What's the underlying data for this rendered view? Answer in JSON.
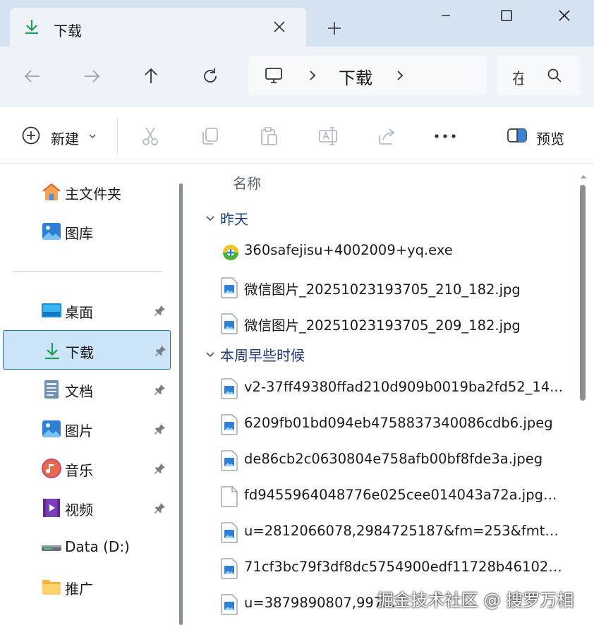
{
  "window": {
    "tab_title": "下载",
    "icons": {
      "tab": "download-icon",
      "close_tab": "close-icon",
      "new_tab": "plus-icon",
      "minimize": "minimize-icon",
      "maximize": "maximize-icon",
      "close": "close-icon"
    }
  },
  "nav": {
    "address": {
      "location": "下载",
      "root_icon": "this-pc-icon"
    },
    "search": {
      "placeholder_partial": "在"
    },
    "icons": {
      "back": "arrow-left-icon",
      "forward": "arrow-right-icon",
      "up": "arrow-up-icon",
      "refresh": "refresh-icon",
      "search": "search-icon"
    }
  },
  "toolbar": {
    "new_label": "新建",
    "preview_label": "预览",
    "icons": [
      "cut-icon",
      "copy-icon",
      "paste-icon",
      "rename-icon",
      "share-icon",
      "more-icon"
    ]
  },
  "sidebar": {
    "top_items": [
      {
        "label": "主文件夹",
        "icon": "home-icon"
      },
      {
        "label": "图库",
        "icon": "gallery-icon"
      }
    ],
    "quick_access": [
      {
        "label": "桌面",
        "icon": "desktop-icon",
        "pinned": true
      },
      {
        "label": "下载",
        "icon": "download-icon",
        "pinned": true,
        "selected": true
      },
      {
        "label": "文档",
        "icon": "documents-icon",
        "pinned": true
      },
      {
        "label": "图片",
        "icon": "pictures-icon",
        "pinned": true
      },
      {
        "label": "音乐",
        "icon": "music-icon",
        "pinned": true
      },
      {
        "label": "视频",
        "icon": "videos-icon",
        "pinned": true
      },
      {
        "label": "Data (D:)",
        "icon": "drive-icon",
        "pinned": false
      },
      {
        "label": "推广",
        "icon": "folder-icon",
        "pinned": false
      }
    ]
  },
  "content": {
    "column_header": "名称",
    "groups": [
      {
        "label": "昨天",
        "files": [
          {
            "name": "360safejisu+4002009+yq.exe",
            "type": "exe"
          },
          {
            "name": "微信图片_20251023193705_210_182.jpg",
            "type": "image"
          },
          {
            "name": "微信图片_20251023193705_209_182.jpg",
            "type": "image"
          }
        ]
      },
      {
        "label": "本周早些时候",
        "files": [
          {
            "name": "v2-37ff49380ffad210d909b0019ba2fd52_14...",
            "type": "image"
          },
          {
            "name": "6209fb01bd094eb4758837340086cdb6.jpeg",
            "type": "image"
          },
          {
            "name": "de86cb2c0630804e758afb00bf8fde3a.jpeg",
            "type": "image"
          },
          {
            "name": "fd9455964048776e025cee014043a72a.jpg@...",
            "type": "blank"
          },
          {
            "name": "u=2812066078,2984725187&fm=253&fmt=...",
            "type": "image"
          },
          {
            "name": "71cf3bc79f3df8dc5754900edf11728b461028...",
            "type": "image"
          },
          {
            "name": "u=3879890807,997...",
            "type": "image"
          }
        ]
      }
    ]
  },
  "watermark": "掘金技术社区 @ 搜罗万相",
  "colors": {
    "titlebar": "#d5e3f0",
    "navbar": "#eef3f9",
    "selection": "#cce4f7",
    "selection_border": "#1f6fb5",
    "group_text": "#1f3f77",
    "download_green": "#1a9e5a"
  }
}
